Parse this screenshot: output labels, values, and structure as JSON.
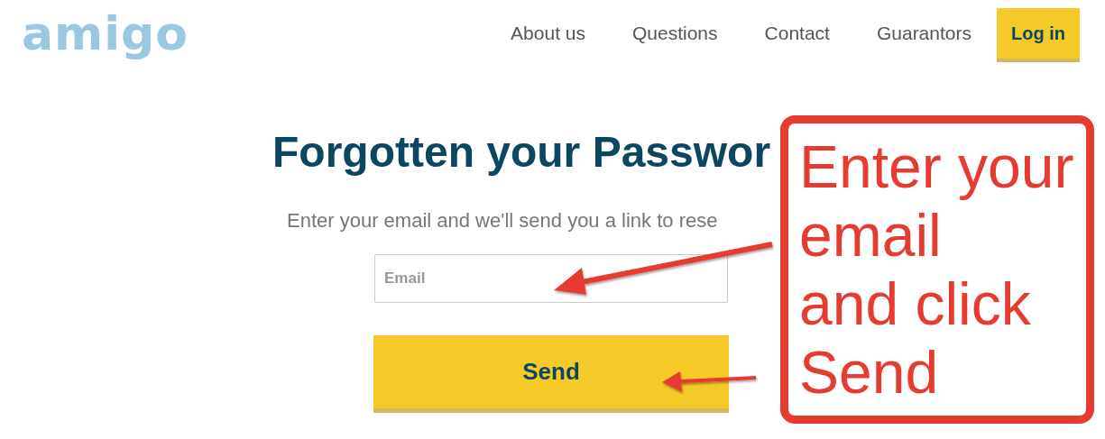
{
  "logo": {
    "text": "amigo"
  },
  "nav": {
    "links": [
      "About us",
      "Questions",
      "Contact",
      "Guarantors"
    ],
    "login_button": "Log in"
  },
  "form": {
    "heading": "Forgotten your Passwor",
    "subtitle": "Enter your email and we'll send you a link to rese",
    "email_field": {
      "placeholder": "Email"
    },
    "send_button": "Send"
  },
  "annotation": {
    "lines": [
      "Enter your",
      "email",
      "and click",
      "Send"
    ]
  }
}
